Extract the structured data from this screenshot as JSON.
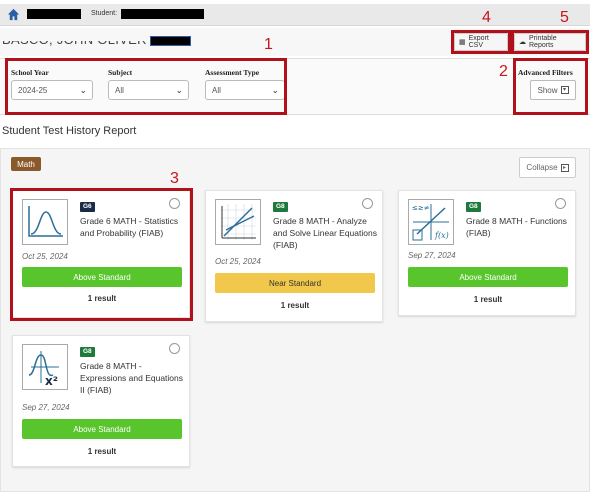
{
  "topbar": {
    "student_label": "Student:"
  },
  "header": {
    "student_name": "BASCO, JOHN OLIVER",
    "export_label": "Export CSV",
    "printable_label": "Printable Reports"
  },
  "annotations": [
    "1",
    "2",
    "3",
    "4",
    "5"
  ],
  "filters": {
    "school_year": {
      "label": "School Year",
      "value": "2024-25"
    },
    "subject": {
      "label": "Subject",
      "value": "All"
    },
    "assessment_type": {
      "label": "Assessment Type",
      "value": "All"
    },
    "advanced": {
      "label": "Advanced Filters",
      "button": "Show"
    }
  },
  "report_title": "Student Test History Report",
  "subject_badge": "Math",
  "collapse_label": "Collapse",
  "colors": {
    "above": "#57c52b",
    "near": "#f1c84b",
    "g6": "#1c2b45",
    "g8": "#1e7a3c",
    "annotation": "#c4161c"
  },
  "cards": [
    {
      "grade": "G6",
      "title": "Grade 6 MATH - Statistics and Probability (FIAB)",
      "date": "Oct 25, 2024",
      "status": "Above Standard",
      "results": "1 result",
      "icon": "normal-distribution-icon"
    },
    {
      "grade": "G8",
      "title": "Grade 8 MATH - Analyze and Solve Linear Equations (FIAB)",
      "date": "Oct 25, 2024",
      "status": "Near Standard",
      "results": "1 result",
      "icon": "linear-graph-icon"
    },
    {
      "grade": "G8",
      "title": "Grade 8 MATH - Functions (FIAB)",
      "date": "Sep 27, 2024",
      "status": "Above Standard",
      "results": "1 result",
      "icon": "functions-icon"
    },
    {
      "grade": "G8",
      "title": "Grade 8 MATH - Expressions and Equations II (FIAB)",
      "date": "Sep 27, 2024",
      "status": "Above Standard",
      "results": "1 result",
      "icon": "expressions-icon"
    }
  ]
}
